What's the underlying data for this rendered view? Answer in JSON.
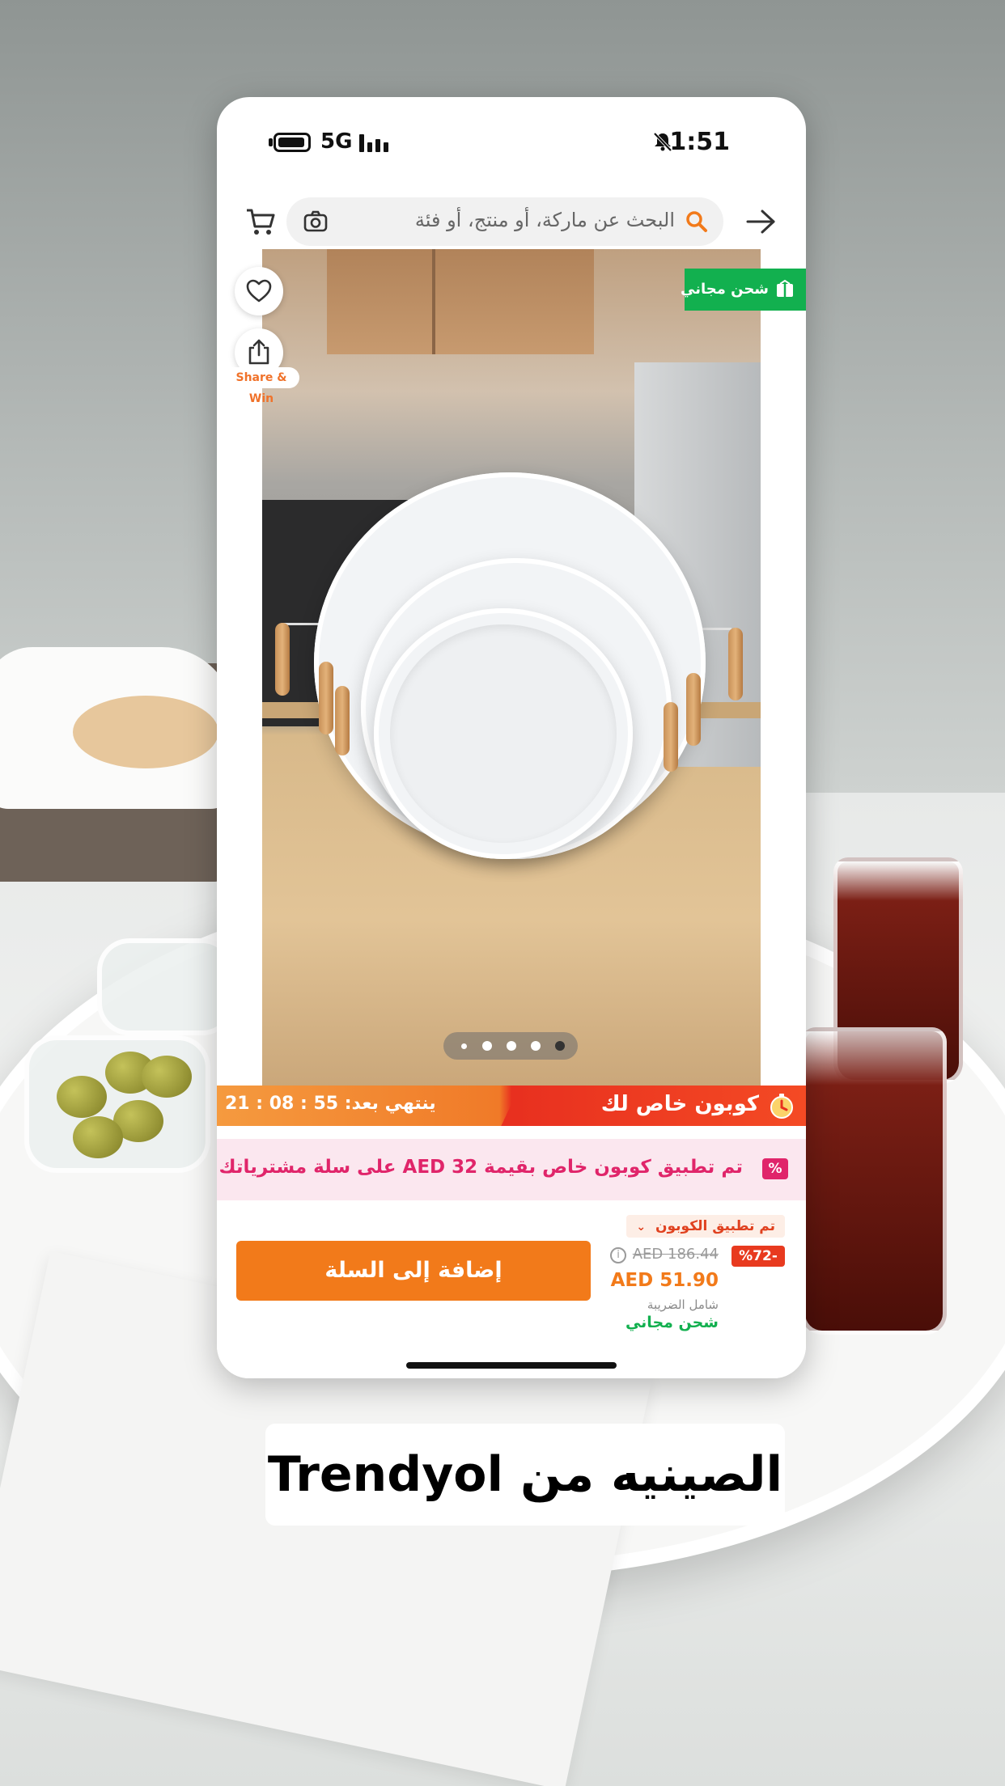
{
  "status_bar": {
    "network": "5G",
    "time": "1:51"
  },
  "search": {
    "placeholder": "البحث عن ماركة، أو منتج، أو فئة"
  },
  "gallery": {
    "share_label": "Share & Win",
    "free_shipping_badge": "شحن مجاني",
    "image_count": 5,
    "active_image_index": 5
  },
  "coupon_bar": {
    "title": "كوبون خاص لك",
    "ends_label": "ينتهي بعد:",
    "countdown": "21 : 08 : 55"
  },
  "notice": {
    "icon_text": "%",
    "text": "تم تطبيق كوبون خاص بقيمة AED 32 على سلة مشترياتك!"
  },
  "pricing": {
    "coupon_applied": "تم تطبيق الكوبون",
    "discount": "%72-",
    "old_price": "AED 186.44",
    "new_price": "AED 51.90",
    "tax_note": "شامل الضريبة",
    "free_shipping": "شحن مجاني"
  },
  "actions": {
    "add_to_cart": "إضافة إلى السلة"
  },
  "caption": {
    "text": "الصينيه من Trendyol"
  },
  "colors": {
    "brand_orange": "#f27a1a",
    "coupon_red": "#e8301f",
    "free_shipping_green": "#12b04f",
    "notice_pink": "#e0256a"
  },
  "icons": [
    "battery-icon",
    "signal-icon",
    "bell-off-icon",
    "cart-icon",
    "camera-icon",
    "search-icon",
    "back-arrow-icon",
    "heart-icon",
    "share-icon",
    "box-icon",
    "coupon-icon",
    "info-icon",
    "chevron-down-icon"
  ]
}
